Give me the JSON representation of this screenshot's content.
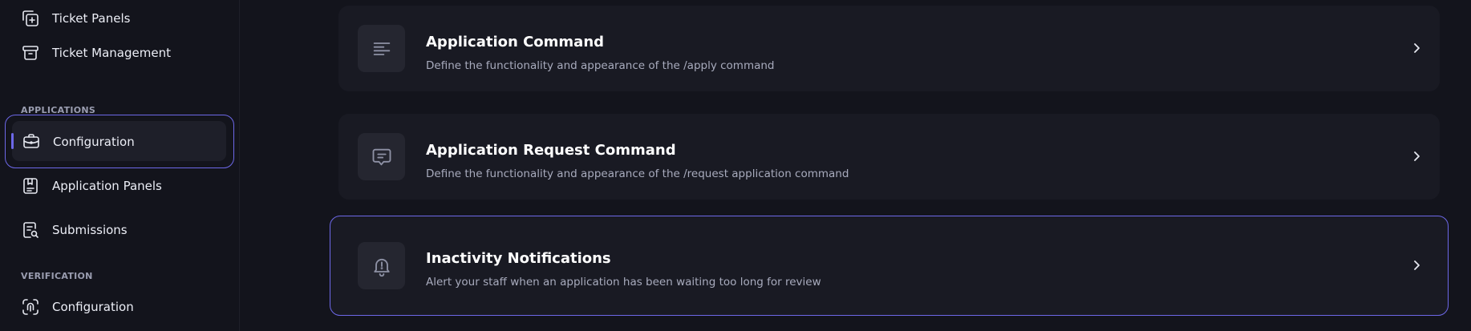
{
  "sidebar": {
    "tickets": {
      "items": [
        {
          "label": "Ticket Panels",
          "icon": "ticket-panels-icon"
        },
        {
          "label": "Ticket Management",
          "icon": "archive-box-icon"
        }
      ]
    },
    "applications": {
      "section_label": "APPLICATIONS",
      "items": [
        {
          "label": "Configuration",
          "icon": "briefcase-icon",
          "active": true
        },
        {
          "label": "Application Panels",
          "icon": "bookmark-document-icon"
        },
        {
          "label": "Submissions",
          "icon": "document-search-icon"
        }
      ]
    },
    "verification": {
      "section_label": "VERIFICATION",
      "items": [
        {
          "label": "Configuration",
          "icon": "fingerprint-icon"
        }
      ]
    }
  },
  "main": {
    "cards": [
      {
        "title": "Application Command",
        "description": "Define the functionality and appearance of the /apply command",
        "icon": "text-lines-icon"
      },
      {
        "title": "Application Request Command",
        "description": "Define the functionality and appearance of the /request application command",
        "icon": "chat-bubble-icon"
      },
      {
        "title": "Inactivity Notifications",
        "description": "Alert your staff when an application has been waiting too long for review",
        "icon": "bell-alert-icon",
        "highlighted": true
      }
    ]
  },
  "colors": {
    "background": "#13141c",
    "card": "#191a23",
    "icon_box": "#252630",
    "accent": "#6d68e8",
    "text_primary": "#ffffff",
    "text_secondary": "#a8abbd",
    "section_label": "#9a9db0"
  }
}
